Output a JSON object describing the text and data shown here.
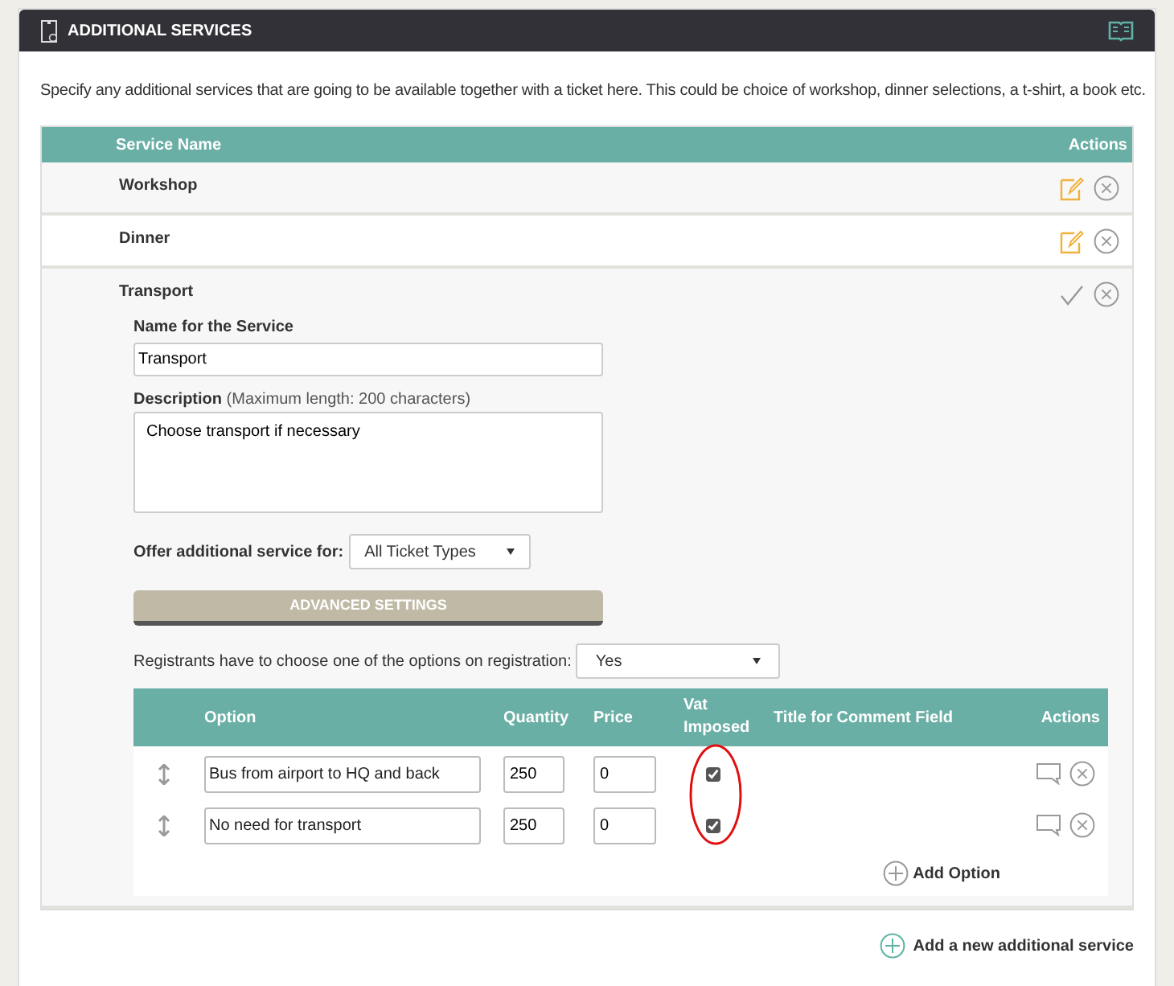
{
  "header": {
    "title": "ADDITIONAL SERVICES"
  },
  "intro": "Specify any additional services that are going to be available together with a ticket here. This could be choice of workshop, dinner selections, a t-shirt, a book etc.",
  "services_table": {
    "columns": [
      "Service Name",
      "Actions"
    ],
    "services": [
      {
        "name": "Workshop",
        "expanded": false
      },
      {
        "name": "Dinner",
        "expanded": false
      },
      {
        "name": "Transport",
        "expanded": true,
        "form": {
          "name_label": "Name for the Service",
          "name_value": "Transport",
          "description_label": "Description",
          "description_hint": "(Maximum length: 200 characters)",
          "description_value": "Choose transport if necessary",
          "offer_label": "Offer additional service for:",
          "offer_value": "All Ticket Types",
          "advanced_button": "ADVANCED SETTINGS",
          "choose_label": "Registrants have to choose one of the options on registration:",
          "choose_value": "Yes",
          "options_table": {
            "columns": [
              "Option",
              "Quantity",
              "Price",
              "Vat Imposed",
              "Title for Comment Field",
              "Actions"
            ],
            "options": [
              {
                "option": "Bus from airport to HQ and back",
                "quantity": "250",
                "price": "0",
                "vat_imposed": true
              },
              {
                "option": "No need for transport",
                "quantity": "250",
                "price": "0",
                "vat_imposed": true
              }
            ]
          },
          "add_option": "Add Option"
        }
      }
    ]
  },
  "add_service": "Add a new additional service"
}
